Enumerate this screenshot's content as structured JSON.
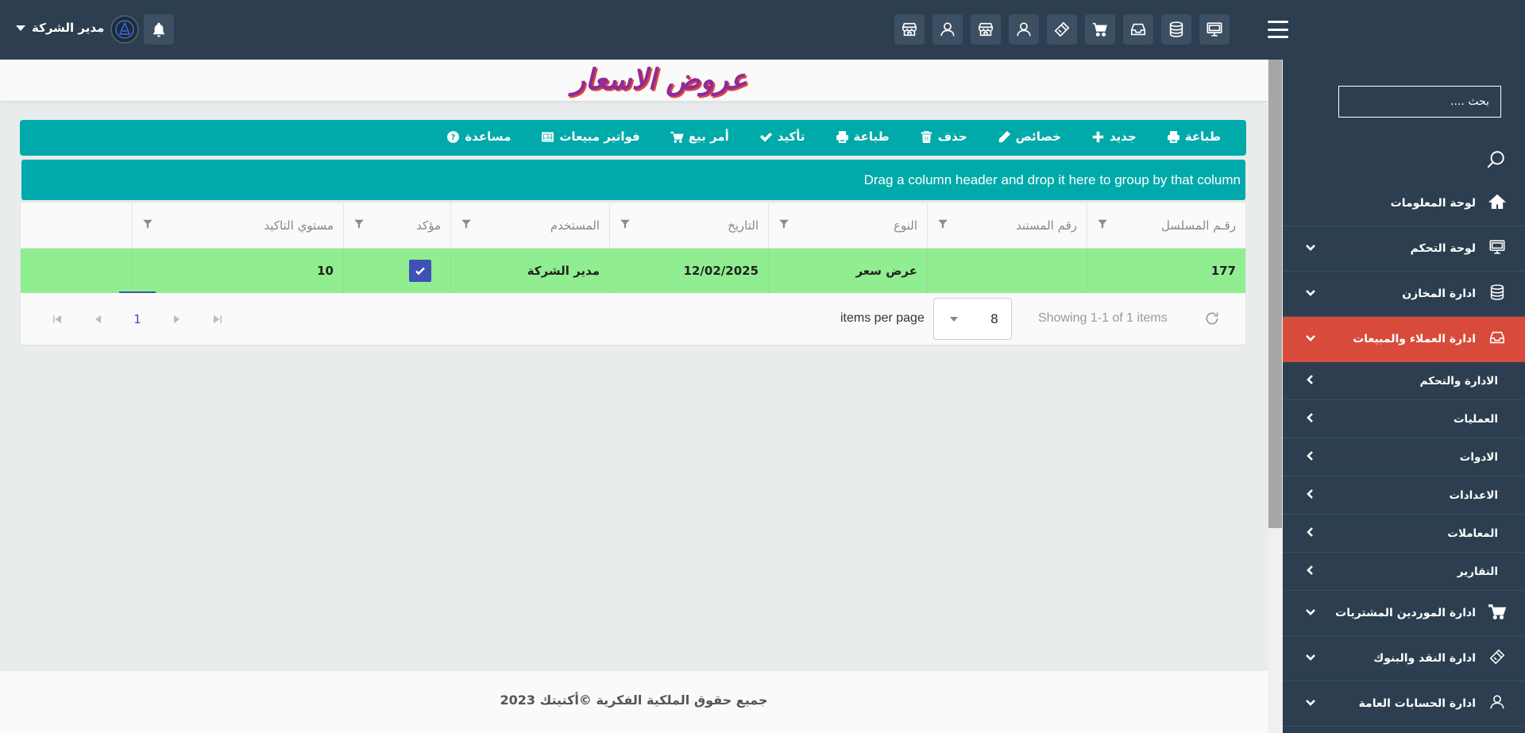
{
  "header": {
    "user_name": "مدير الشركة",
    "toolbar_icons": [
      "monitor-icon",
      "database-icon",
      "inbox-icon",
      "cart-icon",
      "ticket-icon",
      "user-icon",
      "store-icon",
      "user-icon",
      "store-icon"
    ]
  },
  "sidebar": {
    "search_placeholder": "بحث ....",
    "items": [
      {
        "label": "لوحة المعلومات",
        "icon": "home-icon"
      },
      {
        "label": "لوحة التحكم",
        "icon": "monitor-icon"
      },
      {
        "label": "ادارة المخازن",
        "icon": "database-icon"
      },
      {
        "label": "ادارة العملاء والمبيعات",
        "icon": "inbox-icon",
        "active": true
      },
      {
        "label": "ادارة الموردين المشتريات",
        "icon": "cart-icon"
      },
      {
        "label": "ادارة النقد والبنوك",
        "icon": "ticket-icon"
      },
      {
        "label": "ادارة الحسابات العامة",
        "icon": "user-icon"
      }
    ],
    "subitems": [
      "الادارة والتحكم",
      "العمليات",
      "الادوات",
      "الاعدادات",
      "المعاملات",
      "التقارير"
    ]
  },
  "page": {
    "title": "عروض الاسعار"
  },
  "toolbar": {
    "print": "طباعة",
    "new": "جديد",
    "edit": "خصائص",
    "delete": "حذف",
    "print2": "طباعة",
    "confirm": "تأكيد",
    "sale_order": "أمر بيع",
    "sales_invoices": "فواتير مبيعات",
    "help": "مساعدة"
  },
  "grid": {
    "group_hint": "Drag a column header and drop it here to group by that column",
    "columns": [
      "رقـم المسلسل",
      "رقم المستند",
      "النوع",
      "التاريخ",
      "المستخدم",
      "مؤكد",
      "مستوي التاكيد"
    ],
    "rows": [
      {
        "serial": "177",
        "doc_no": "",
        "type": "عرض سعر",
        "date": "12/02/2025",
        "user": "مدير الشركة",
        "confirmed": true,
        "confirm_level": "10"
      }
    ],
    "row_color": "#90ee90"
  },
  "pager": {
    "current_page": "1",
    "items_per_page_label": "items per page",
    "items_per_page_value": "8",
    "showing_text": "Showing 1-1 of 1 items"
  },
  "footer": {
    "text": "جميع حقوق الملكية الفكرية ©أكتيتك 2023"
  },
  "colors": {
    "topbar": "#2c3e50",
    "accent": "#00aaaa",
    "active_menu": "#d84b3a"
  }
}
